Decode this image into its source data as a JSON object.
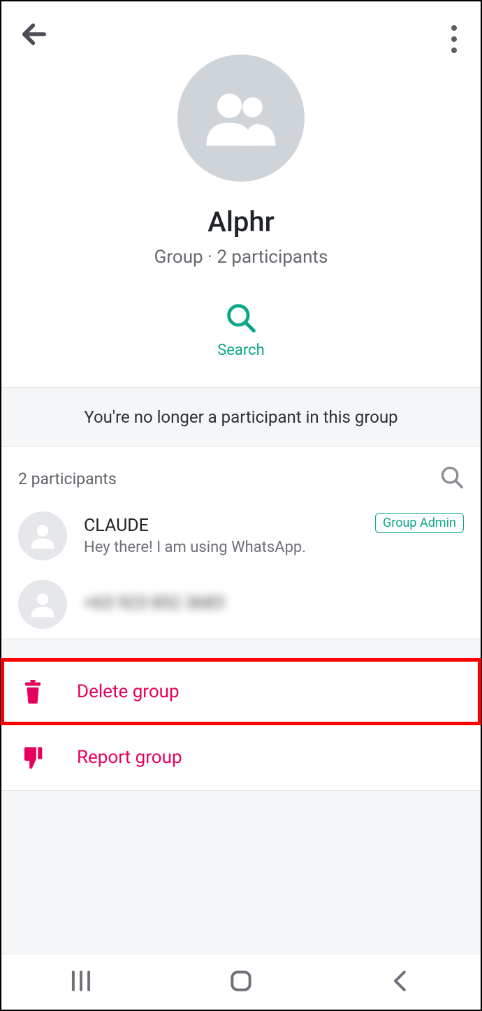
{
  "header": {
    "title": "Alphr",
    "subtitle": "Group · 2 participants",
    "search_label": "Search"
  },
  "notice": "You're no longer a participant in this group",
  "participants_section": {
    "count_label": "2 participants"
  },
  "participants": [
    {
      "name": "CLAUDE",
      "status": "Hey there! I am using WhatsApp.",
      "admin_badge": "Group Admin"
    },
    {
      "name": "+63 923 852 3683",
      "status": ""
    }
  ],
  "actions": {
    "delete": "Delete group",
    "report": "Report group"
  }
}
